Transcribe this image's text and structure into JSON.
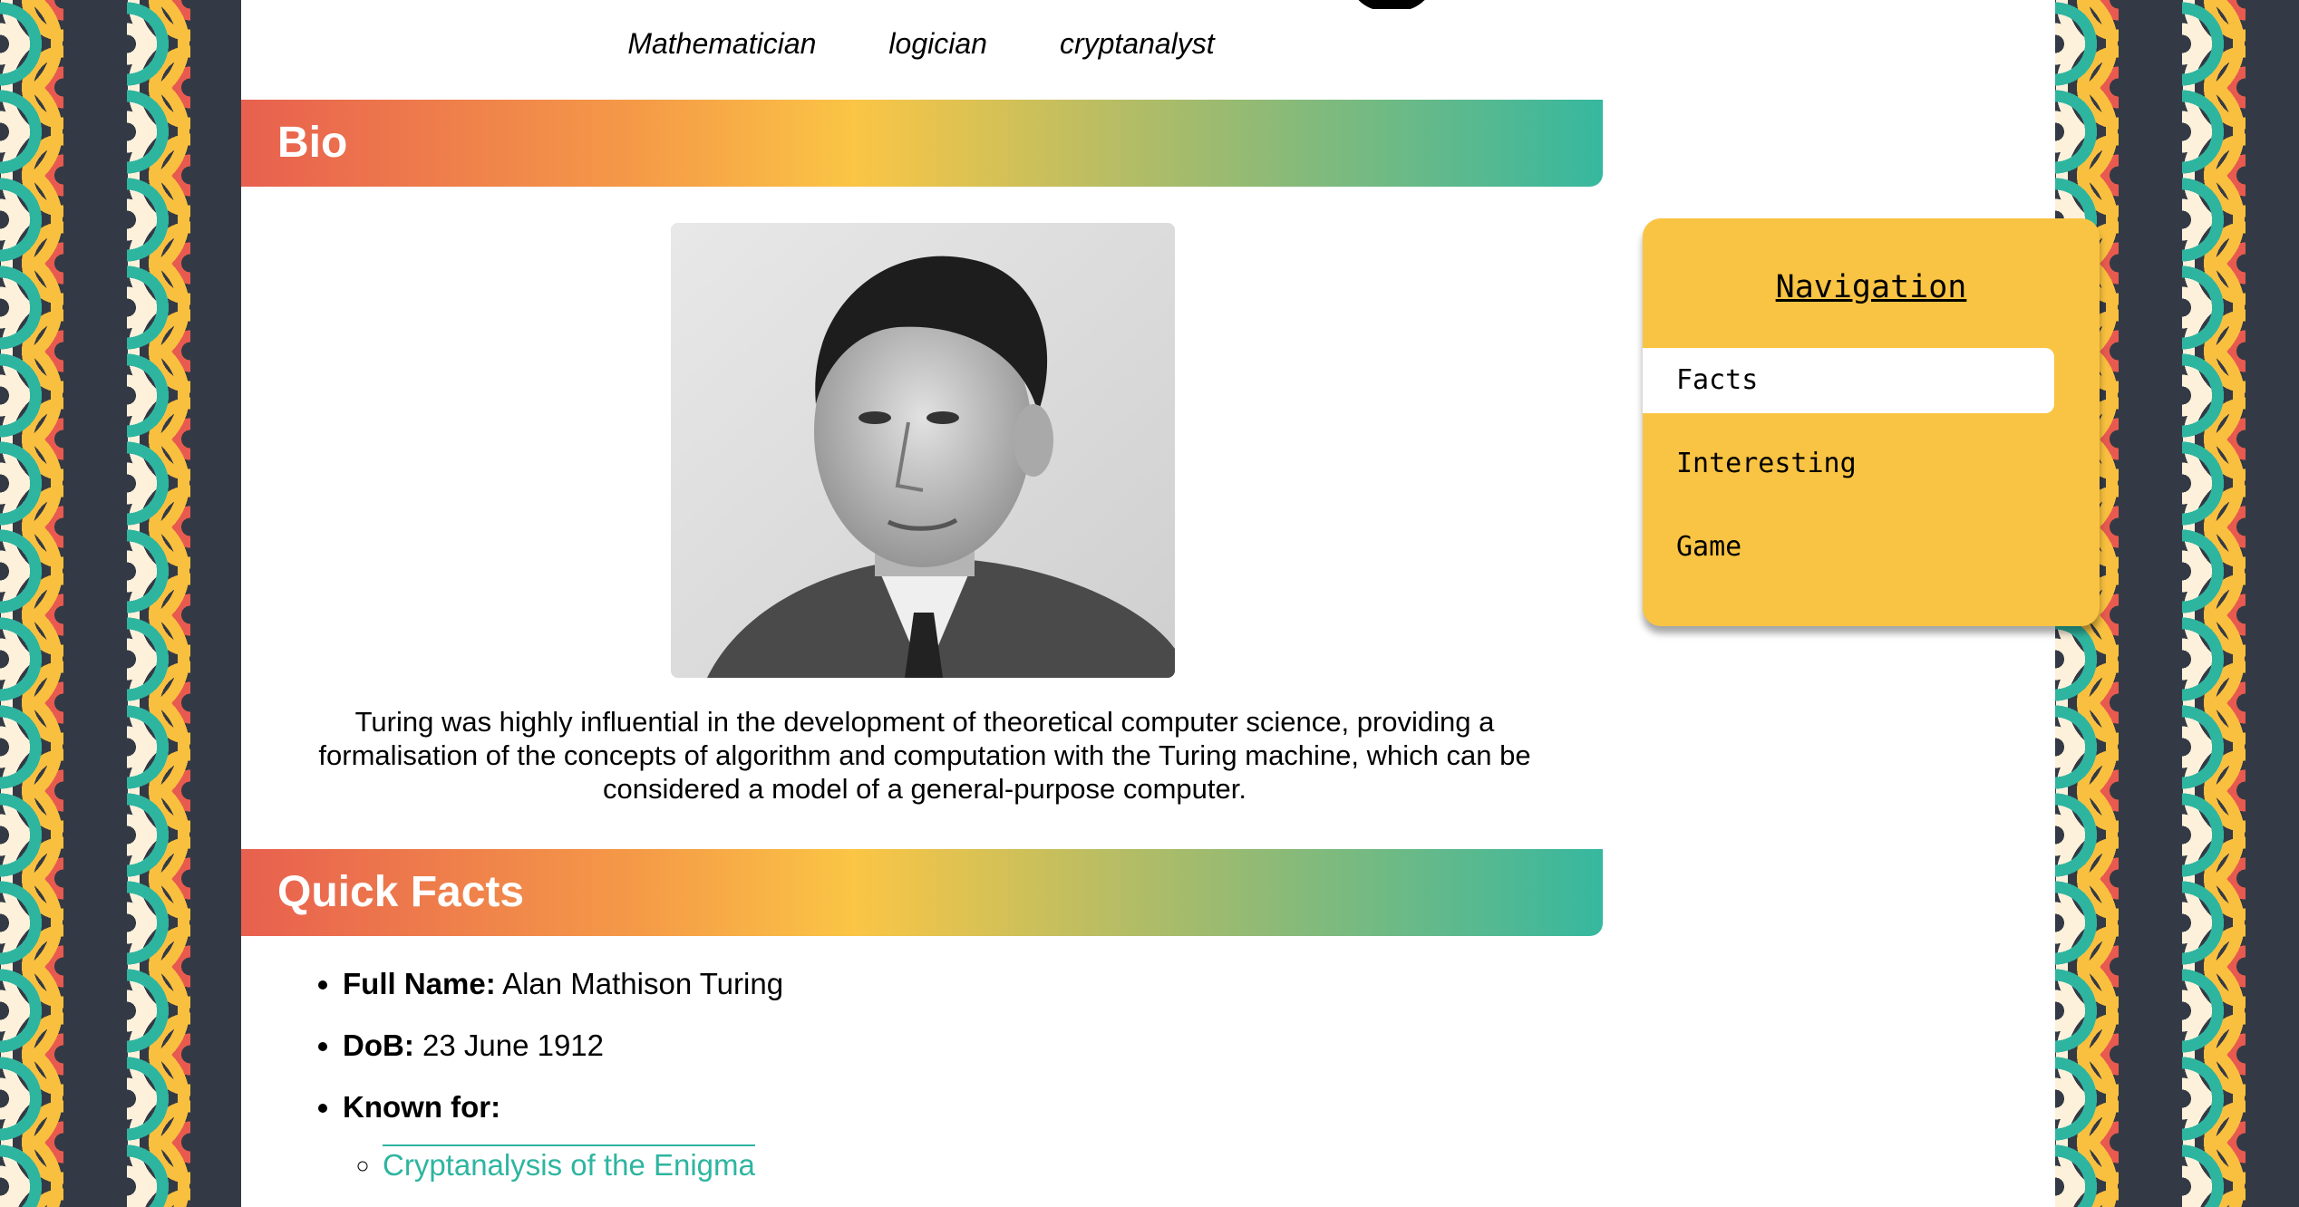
{
  "header": {
    "subtitle_items": [
      "Mathematician",
      "logician",
      "cryptanalyst"
    ]
  },
  "bio": {
    "heading": "Bio",
    "text": "Turing was highly influential in the development of theoretical computer science, providing a formalisation of the concepts of algorithm and computation with the Turing machine, which can be considered a model of a general-purpose computer."
  },
  "quick_facts": {
    "heading": "Quick Facts",
    "items": [
      {
        "label": "Full Name:",
        "value": "Alan Mathison Turing"
      },
      {
        "label": "DoB:",
        "value": "23 June 1912"
      },
      {
        "label": "Known for:",
        "value": ""
      }
    ],
    "known_for": [
      "Cryptanalysis of the Enigma"
    ]
  },
  "navigation": {
    "title": "Navigation",
    "items": [
      "Facts",
      "Interesting",
      "Game"
    ],
    "active": "Facts"
  },
  "colors": {
    "accent_teal": "#2eb5a0",
    "accent_yellow": "#f9c443",
    "accent_red": "#e8604f",
    "wave_dark": "#343a45"
  }
}
